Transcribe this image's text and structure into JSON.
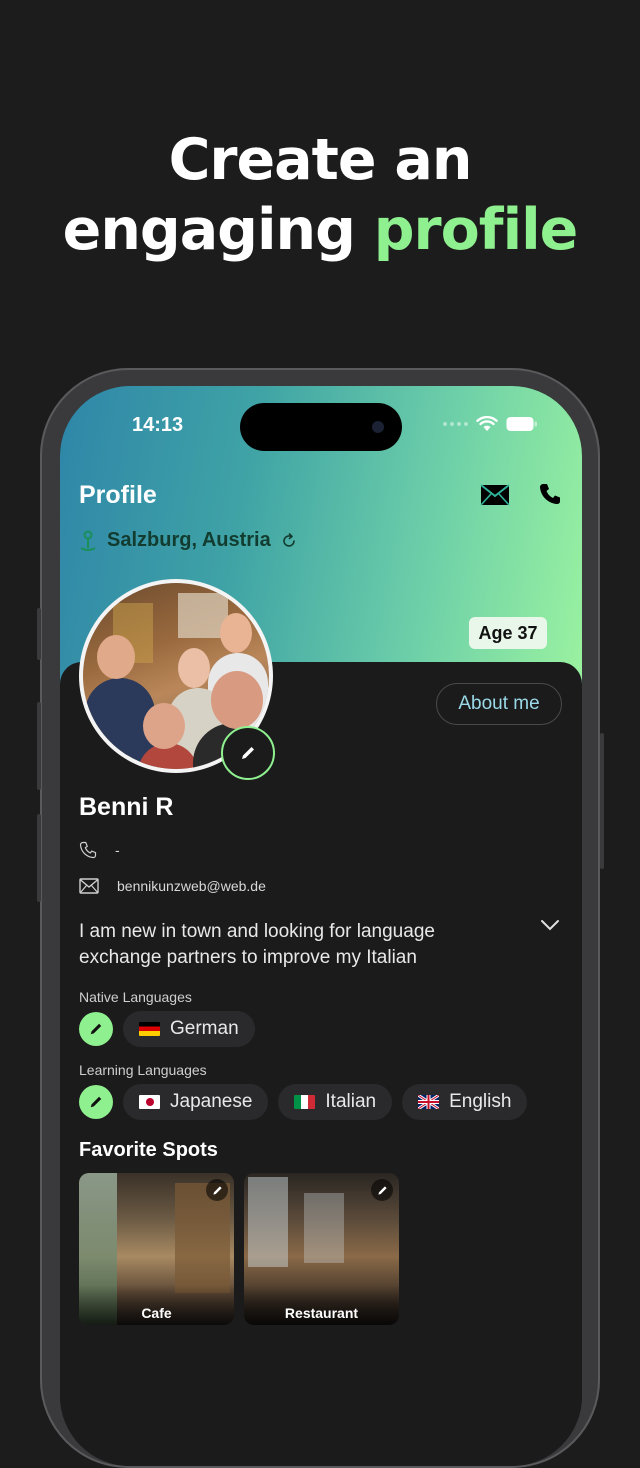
{
  "headline": {
    "line1": "Create an",
    "line2_start": "engaging ",
    "line2_accent": "profile"
  },
  "status_bar": {
    "time": "14:13"
  },
  "header": {
    "title": "Profile",
    "location": "Salzburg, Austria"
  },
  "profile": {
    "age_badge": "Age 37",
    "about_button": "About me",
    "name": "Benni R",
    "phone": "-",
    "email": "bennikunzweb@web.de",
    "bio": "I am new in town and looking for language exchange partners to improve my Italian"
  },
  "native_languages": {
    "label": "Native Languages",
    "items": [
      {
        "name": "German",
        "flag": "de-flag"
      }
    ]
  },
  "learning_languages": {
    "label": "Learning Languages",
    "items": [
      {
        "name": "Japanese",
        "flag": "jp-flag"
      },
      {
        "name": "Italian",
        "flag": "it-flag"
      },
      {
        "name": "English",
        "flag": "gb-flag"
      }
    ]
  },
  "favorite_spots": {
    "title": "Favorite Spots",
    "items": [
      {
        "label": "Cafe"
      },
      {
        "label": "Restaurant"
      }
    ]
  },
  "colors": {
    "accent": "#8ff08f",
    "background": "#1c1c1c",
    "panel": "#1b1b1c",
    "chip": "#2a2a2c",
    "gradient_start": "#2f86a8",
    "gradient_end": "#9af2a0",
    "about_text": "#9ad9e8"
  },
  "icons": {
    "mail": "mail-icon",
    "phone": "phone-icon",
    "location": "location-pin-icon",
    "refresh": "refresh-icon",
    "edit": "pencil-icon",
    "chevron": "chevron-down-icon"
  }
}
